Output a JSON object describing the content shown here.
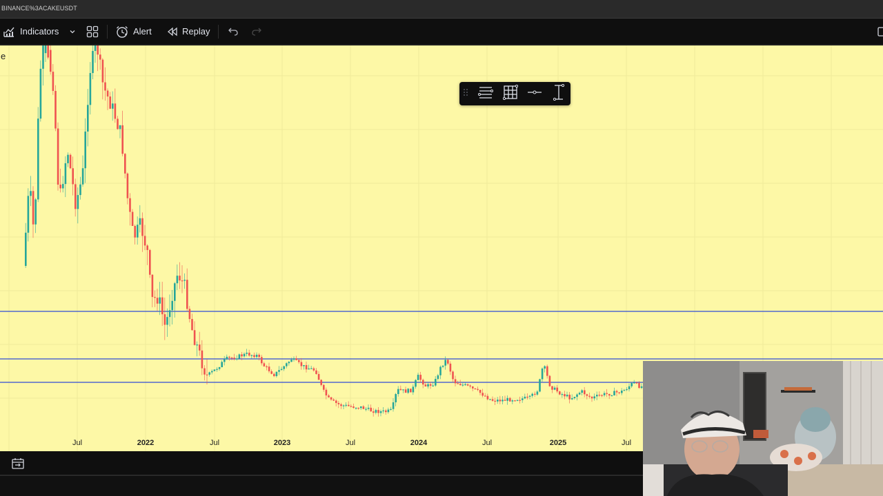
{
  "window": {
    "title": "BINANCE%3ACAKEUSDT"
  },
  "toolbar": {
    "indicators_label": "Indicators",
    "alert_label": "Alert",
    "replay_label": "Replay"
  },
  "chart": {
    "partial_label": "e",
    "background_color": "#fdf8a6",
    "x_axis_labels": [
      {
        "text": "Jul",
        "bold": false
      },
      {
        "text": "2022",
        "bold": true
      },
      {
        "text": "Jul",
        "bold": false
      },
      {
        "text": "2023",
        "bold": true
      },
      {
        "text": "Jul",
        "bold": false
      },
      {
        "text": "2024",
        "bold": true
      },
      {
        "text": "Jul",
        "bold": false
      },
      {
        "text": "2025",
        "bold": true
      },
      {
        "text": "Jul",
        "bold": false
      }
    ],
    "horizontal_lines_color": "#2f4bd6",
    "up_color": "#26a69a",
    "down_color": "#ef5350"
  },
  "floating_toolbar": {
    "items": [
      "list-lines-icon",
      "grid-icon",
      "horizontal-ray-icon",
      "vertical-range-icon"
    ]
  },
  "bottombar": {
    "icon": "date-range-icon"
  },
  "webcam": {
    "content": "presenter-webcam-feed"
  }
}
